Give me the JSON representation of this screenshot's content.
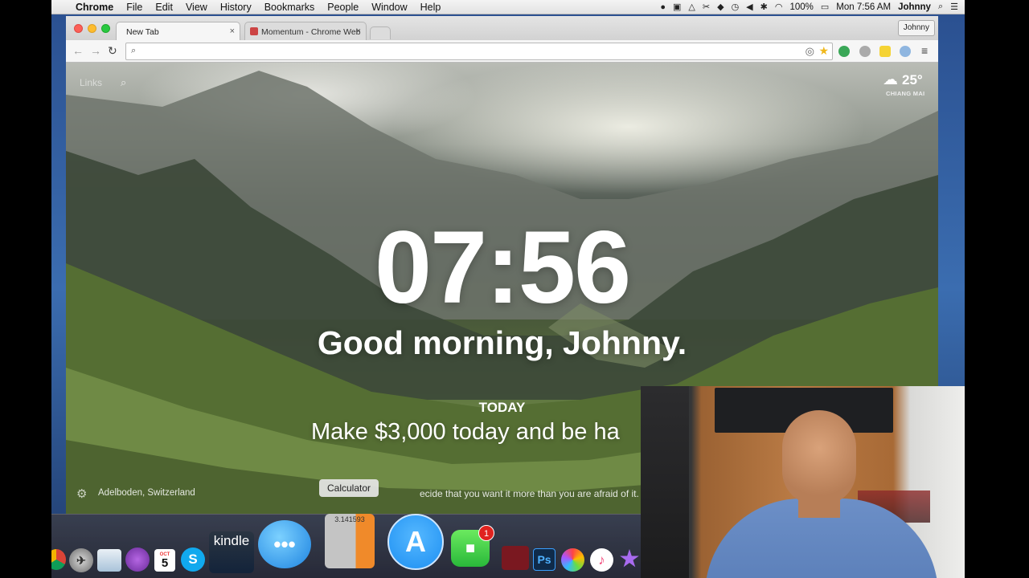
{
  "menubar": {
    "app": "Chrome",
    "items": [
      "File",
      "Edit",
      "View",
      "History",
      "Bookmarks",
      "People",
      "Window",
      "Help"
    ],
    "battery": "100%",
    "clock": "Mon 7:56 AM",
    "user": "Johnny"
  },
  "browser": {
    "tabs": [
      {
        "label": "New Tab",
        "icon": "blank-page-icon"
      },
      {
        "label": "Momentum - Chrome Web",
        "icon": "chrome-webstore-icon"
      }
    ],
    "profile": "Johnny",
    "omnibox_value": ""
  },
  "momentum": {
    "links_label": "Links",
    "weather_temp": "25°",
    "weather_location": "CHIANG MAI",
    "weather_icon": "partly-cloudy-icon",
    "clock": "07:56",
    "greeting": "Good morning, Johnny.",
    "today_label": "TODAY",
    "focus": "Make $3,000 today and be ha",
    "location": "Adelboden, Switzerland",
    "quote": "ecide that you want it more than you are afraid of it."
  },
  "dock": {
    "tooltip": "Calculator",
    "calendar_month": "OCT",
    "calendar_day": "5",
    "kindle_label": "kindle",
    "facetime_badge": "1",
    "calc_display": "3.141593",
    "ps_label": "Ps",
    "items": [
      "chrome-icon",
      "launchpad-icon",
      "preview-icon",
      "podcast-icon",
      "calendar-icon",
      "skype-icon",
      "kindle-icon",
      "messages-icon",
      "calculator-icon",
      "app-store-icon",
      "facetime-icon",
      "photo-booth-icon",
      "photoshop-icon",
      "photos-icon",
      "itunes-icon",
      "imovie-icon"
    ]
  },
  "colors": {
    "accent_blue": "#2f86e6",
    "badge_red": "#e0231f",
    "appstore_blue": "#1d8ff2"
  }
}
